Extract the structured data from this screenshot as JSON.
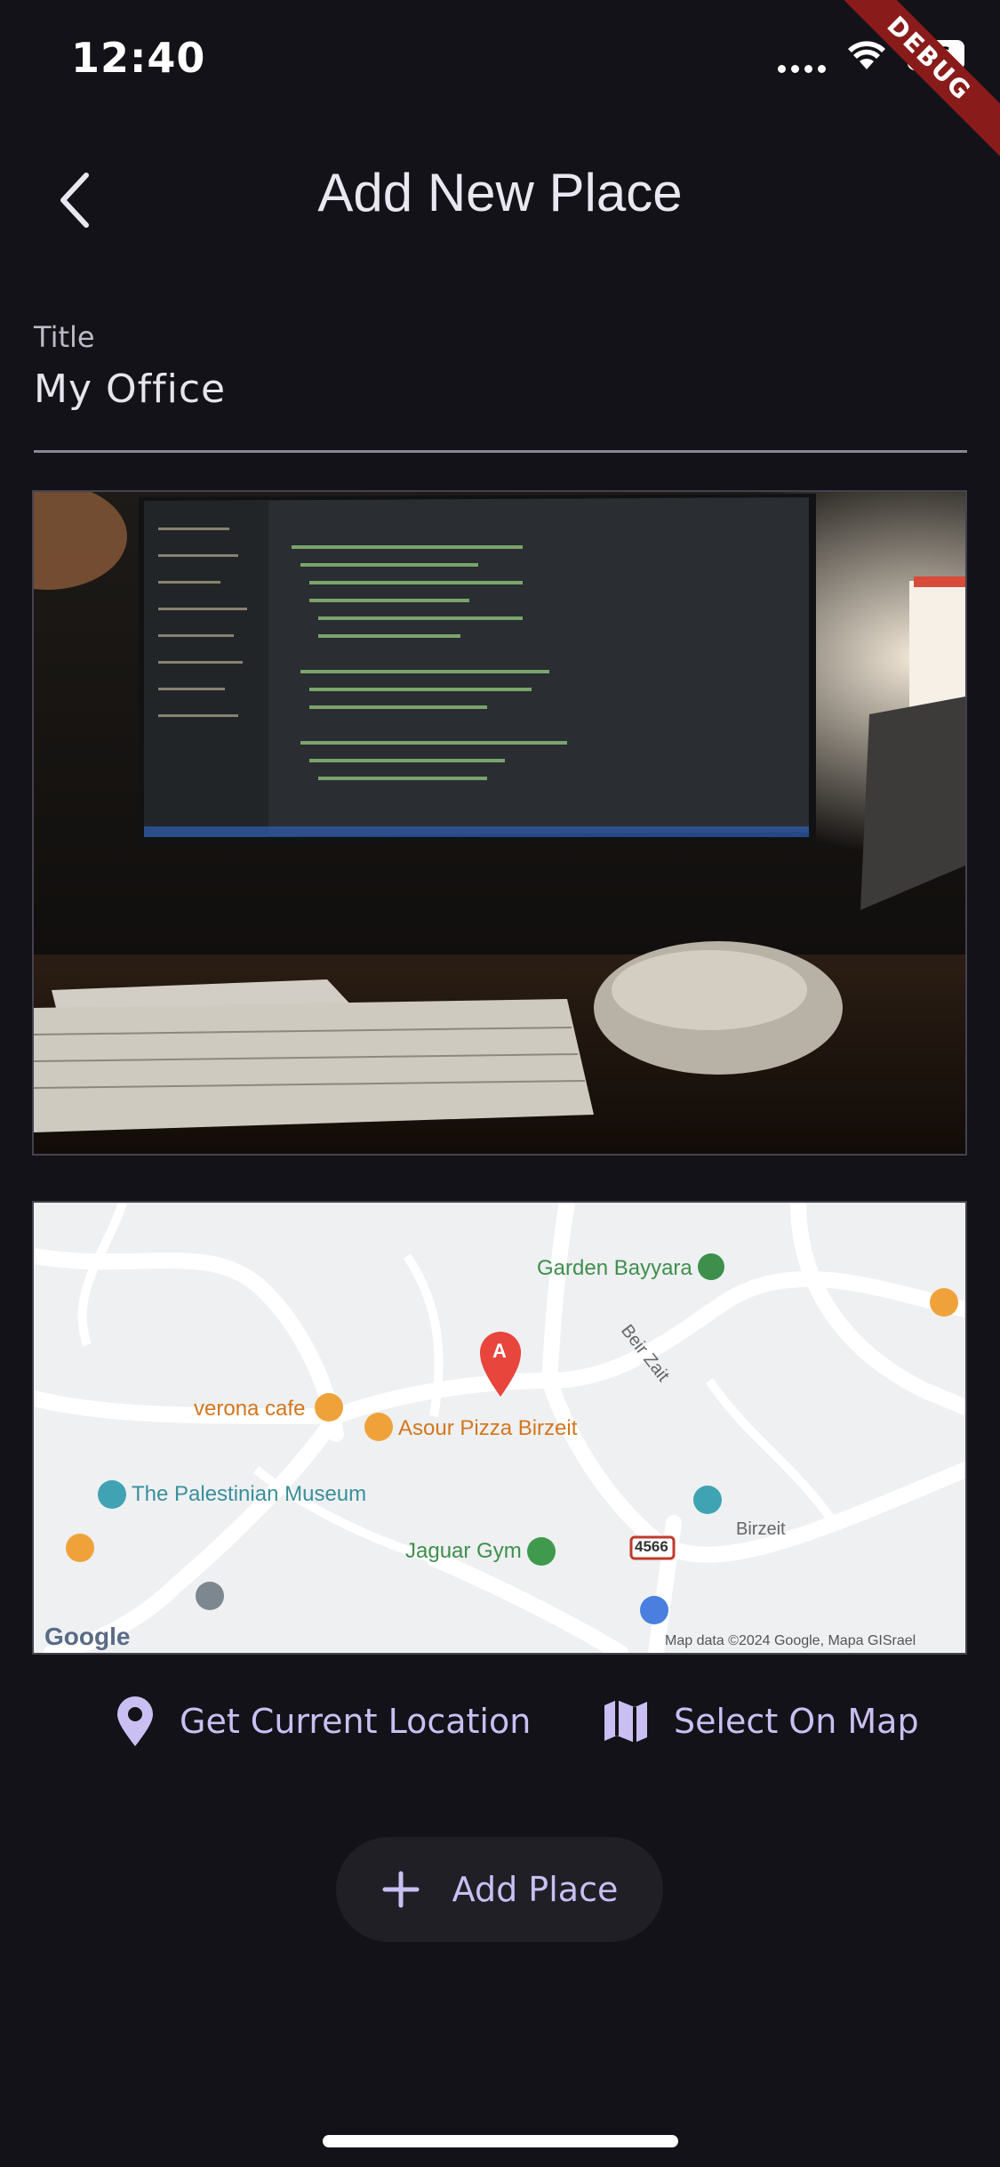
{
  "status": {
    "time": "12:40",
    "battery": "96"
  },
  "debug_banner": "DEBUG",
  "header": {
    "title": "Add New Place"
  },
  "form": {
    "title_label": "Title",
    "title_value": "My Office"
  },
  "map": {
    "labels": {
      "garden": "Garden Bayyara",
      "verona": "verona cafe",
      "asour": "Asour Pizza Birzeit",
      "museum": "The Palestinian Museum",
      "gym": "Jaguar Gym",
      "road1": "Beir Zait",
      "road2": "Birzeit",
      "route": "4566",
      "marker": "A",
      "google": "Google",
      "mapdata": "Map data ©2024 Google, Mapa GISrael"
    }
  },
  "actions": {
    "get_location": "Get Current Location",
    "select_on_map": "Select On Map"
  },
  "submit": {
    "label": "Add Place"
  },
  "colors": {
    "background": "#131218",
    "accent": "#c9bff2",
    "button_bg": "#201f26"
  }
}
